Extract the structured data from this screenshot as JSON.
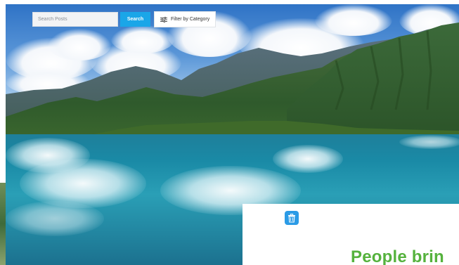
{
  "search": {
    "placeholder": "Search Posts",
    "button_label": "Search"
  },
  "filter": {
    "label": "Filter by Category",
    "icon": "sliders-icon"
  },
  "card": {
    "icon": "trash-icon",
    "heading": "People brin"
  },
  "colors": {
    "search_button": "#1aa6e8",
    "heading": "#55b23d",
    "card_icon": "#2b9be6"
  }
}
